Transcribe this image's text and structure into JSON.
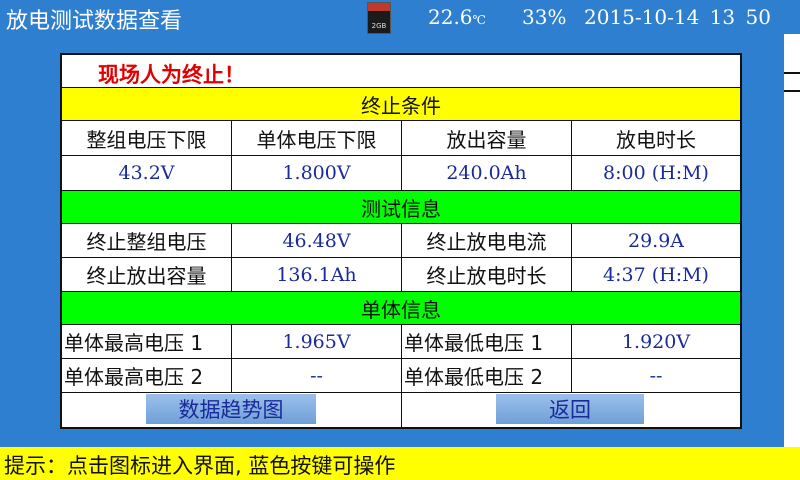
{
  "header": {
    "title": "放电测试数据查看",
    "temperature": "22.6",
    "temperature_unit": "℃",
    "battery": "33%",
    "datetime": "2015-10-14 13 50"
  },
  "status_message": "现场人为终止！",
  "stop_conditions": {
    "title": "终止条件",
    "columns": [
      "整组电压下限",
      "单体电压下限",
      "放出容量",
      "放电时长"
    ],
    "values": [
      "43.2V",
      "1.800V",
      "240.0Ah",
      "8:00 (H:M)"
    ]
  },
  "test_info": {
    "title": "测试信息",
    "rows": [
      {
        "label1": "终止整组电压",
        "value1": "46.48V",
        "label2": "终止放电电流",
        "value2": "29.9A"
      },
      {
        "label1": "终止放出容量",
        "value1": "136.1Ah",
        "label2": "终止放电时长",
        "value2": "4:37 (H:M)"
      }
    ]
  },
  "cell_info": {
    "title": "单体信息",
    "rows": [
      {
        "label1": "单体最高电压 1",
        "value1": "1.965V",
        "label2": "单体最低电压 1",
        "value2": "1.920V"
      },
      {
        "label1": "单体最高电压 2",
        "value1": "--",
        "label2": "单体最低电压 2",
        "value2": "--"
      }
    ]
  },
  "buttons": {
    "trend": "数据趋势图",
    "back": "返回"
  },
  "footer": {
    "hint": "提示：点击图标进入界面, 蓝色按键可操作"
  },
  "colors": {
    "background": "#2f7fd0",
    "band_yellow": "#ffff00",
    "band_green": "#00ff00",
    "value_blue": "#1a2a9a",
    "warning_red": "#e00000"
  },
  "icons": {
    "storage": "sd-card-icon"
  }
}
